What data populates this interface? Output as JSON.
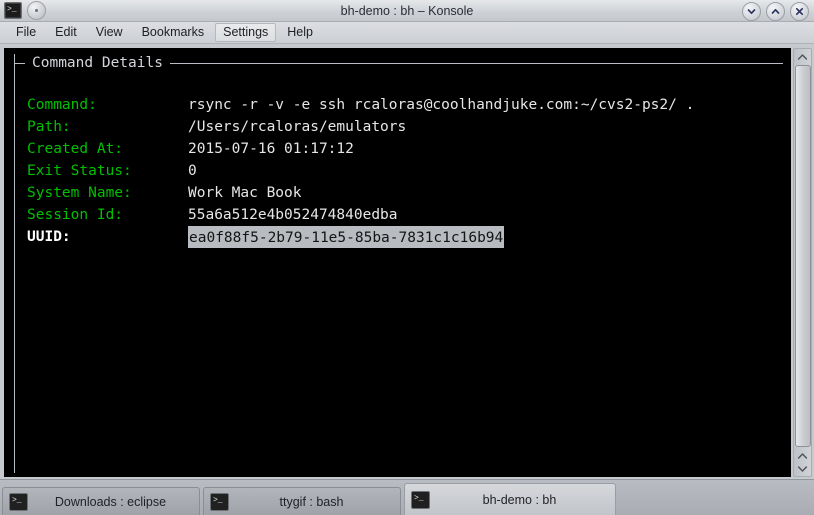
{
  "window": {
    "title": "bh-demo : bh – Konsole",
    "app_icon": "terminal-icon",
    "menu_button_icon": "window-menu-icon",
    "controls": [
      {
        "name": "minimize-button",
        "icon": "chevron-down-icon"
      },
      {
        "name": "maximize-button",
        "icon": "chevron-up-icon"
      },
      {
        "name": "close-button",
        "icon": "close-x-icon"
      }
    ]
  },
  "menubar": {
    "items": [
      {
        "label": "File",
        "active": false
      },
      {
        "label": "Edit",
        "active": false
      },
      {
        "label": "View",
        "active": false
      },
      {
        "label": "Bookmarks",
        "active": false
      },
      {
        "label": "Settings",
        "active": true
      },
      {
        "label": "Help",
        "active": false
      }
    ]
  },
  "terminal": {
    "frame_title": "Command Details",
    "background": "#000000",
    "label_color": "#00c000",
    "value_color": "#e6e6e6",
    "selection_bg": "#b8bcc0",
    "rows": [
      {
        "label": "Command:",
        "value": "rsync -r -v -e ssh rcaloras@coolhandjuke.com:~/cvs2-ps2/ .",
        "bold_label": false,
        "selected": false
      },
      {
        "label": "Path:",
        "value": "/Users/rcaloras/emulators",
        "bold_label": false,
        "selected": false
      },
      {
        "label": "Created At:",
        "value": "2015-07-16 01:17:12",
        "bold_label": false,
        "selected": false
      },
      {
        "label": "Exit Status:",
        "value": "0",
        "bold_label": false,
        "selected": false
      },
      {
        "label": "System Name:",
        "value": "Work Mac Book",
        "bold_label": false,
        "selected": false
      },
      {
        "label": "Session Id:",
        "value": "55a6a512e4b052474840edba",
        "bold_label": false,
        "selected": false
      },
      {
        "label": "UUID:",
        "value": "ea0f88f5-2b79-11e5-85ba-7831c1c16b94",
        "bold_label": true,
        "selected": true
      }
    ]
  },
  "scrollbar": {
    "top_arrow_icon": "chevron-up-icon",
    "bottom_up_arrow_icon": "chevron-up-icon",
    "bottom_down_arrow_icon": "chevron-down-icon"
  },
  "tabbar": {
    "tabs": [
      {
        "label": "Downloads : eclipse",
        "icon": "terminal-icon",
        "active": false
      },
      {
        "label": "ttygif : bash",
        "icon": "terminal-icon",
        "active": false
      },
      {
        "label": "bh-demo : bh",
        "icon": "terminal-icon",
        "active": true
      }
    ]
  }
}
